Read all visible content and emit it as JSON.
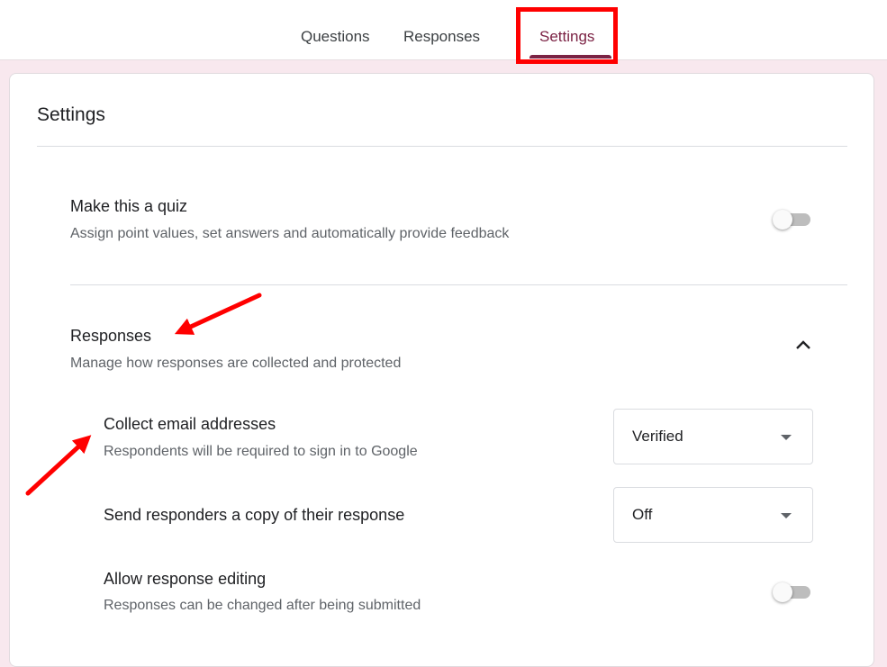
{
  "tabs": [
    {
      "label": "Questions"
    },
    {
      "label": "Responses"
    },
    {
      "label": "Settings"
    }
  ],
  "active_tab": "Settings",
  "colors": {
    "accent": "#7b2244",
    "background": "#f8e8ee",
    "annotation": "#ff0000"
  },
  "settings": {
    "title": "Settings",
    "quiz": {
      "title": "Make this a quiz",
      "description": "Assign point values, set answers and automatically provide feedback",
      "enabled": false
    },
    "responses": {
      "title": "Responses",
      "description": "Manage how responses are collected and protected",
      "expanded": true,
      "icon": "chevron-up-icon",
      "collect_email": {
        "title": "Collect email addresses",
        "description": "Respondents will be required to sign in to Google",
        "value": "Verified"
      },
      "send_copy": {
        "title": "Send responders a copy of their response",
        "value": "Off"
      },
      "allow_editing": {
        "title": "Allow response editing",
        "description": "Responses can be changed after being submitted",
        "enabled": false
      }
    }
  }
}
